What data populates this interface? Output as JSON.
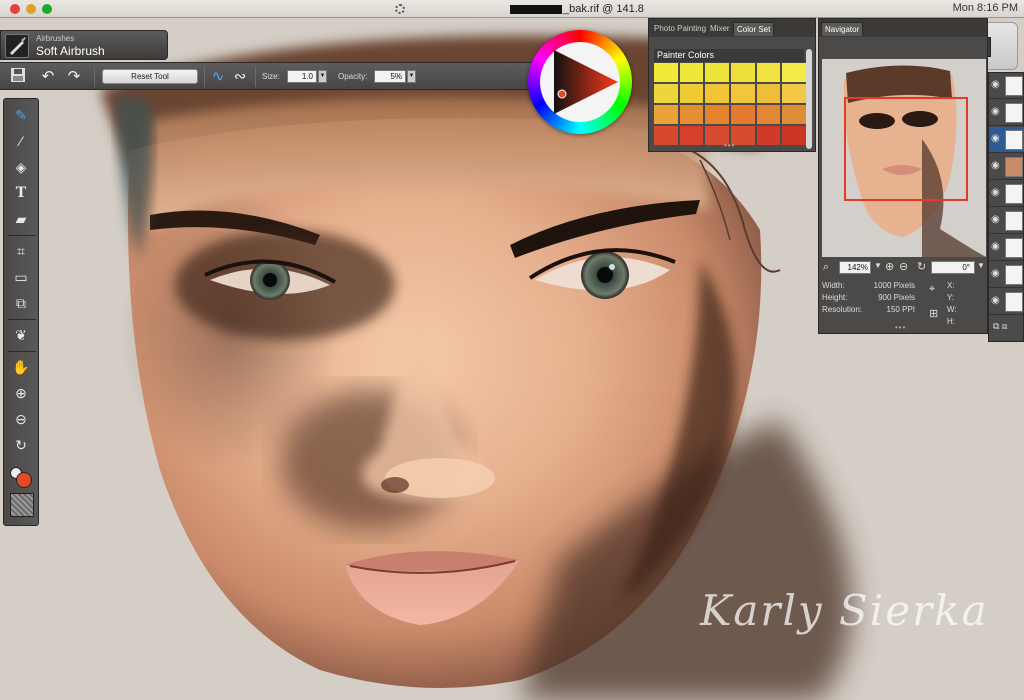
{
  "window": {
    "title_suffix": "_bak.rif @ 141.8",
    "clock": "Mon 8:16 PM"
  },
  "brush_selector": {
    "category": "Airbrushes",
    "variant": "Soft Airbrush"
  },
  "property_bar": {
    "reset_tool_label": "Reset Tool",
    "size_label": "Size:",
    "size_value": "1.0",
    "opacity_label": "Opacity:",
    "opacity_value": "5%"
  },
  "toolbox": {
    "tools": [
      "brush-icon",
      "dropper-icon",
      "paint-bucket-icon",
      "text-icon",
      "eraser-icon",
      "crop-icon",
      "rectangle-select-icon",
      "transform-icon",
      "plant-brush-icon",
      "grabber-hand-icon",
      "zoom-in-icon",
      "zoom-out-icon",
      "rotate-icon"
    ],
    "main_color": "#e34a28"
  },
  "color_panel": {
    "tabs": [
      "Photo Painting",
      "Mixer",
      "Color Set"
    ],
    "active_tab": "Color Set",
    "set_name": "Painter Colors",
    "swatches": [
      "#f2ea3a",
      "#efe63c",
      "#ede23a",
      "#eedf3a",
      "#f0e240",
      "#f4ec46",
      "#efd53c",
      "#edcc36",
      "#efc438",
      "#f2c53e",
      "#f0bd3a",
      "#f2c846",
      "#e9a13a",
      "#e58e32",
      "#e6842e",
      "#e67a30",
      "#e58634",
      "#e08d3a",
      "#d6492c",
      "#d4402a",
      "#d64a30",
      "#d74c2f",
      "#cf3b28",
      "#cc3526"
    ]
  },
  "navigator": {
    "tab_label": "Navigator",
    "zoom_value": "142%",
    "rotate_value": "0°",
    "width_label": "Width:",
    "width_value": "1000 Pixels",
    "height_label": "Height:",
    "height_value": "900 Pixels",
    "resolution_label": "Resolution:",
    "resolution_value": "150 PPI",
    "x_label": "X:",
    "y_label": "Y:",
    "w_label": "W:",
    "h_label": "H:"
  },
  "signature": "Karly Sierka"
}
